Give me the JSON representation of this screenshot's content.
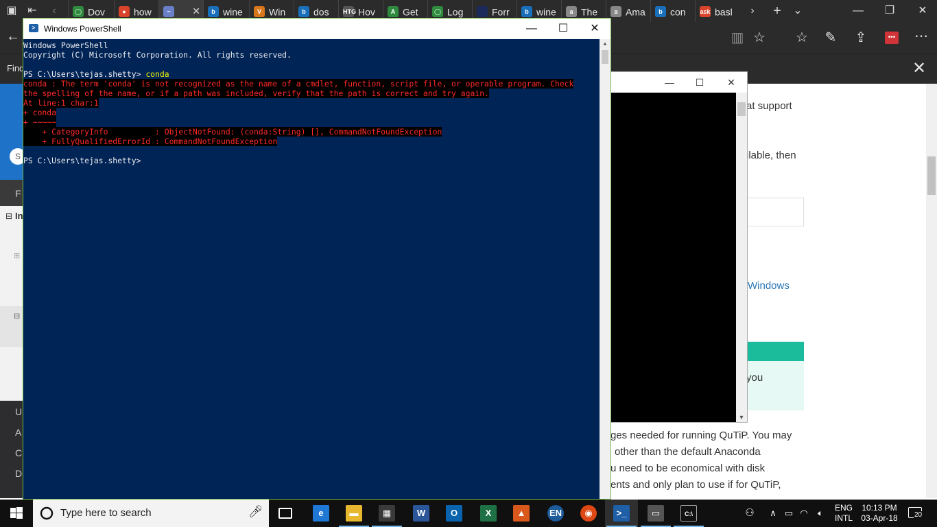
{
  "browser": {
    "tabs": [
      {
        "label": "Dov",
        "color": "#2e8b3e",
        "glyph": "◯"
      },
      {
        "label": "how",
        "color": "#d9442c",
        "glyph": "●"
      },
      {
        "label": "",
        "color": "#6a7fc8",
        "glyph": "~"
      },
      {
        "label": "wine",
        "color": "#1a6fba",
        "glyph": "b"
      },
      {
        "label": "Win",
        "color": "#d8761c",
        "glyph": "V"
      },
      {
        "label": "dos",
        "color": "#1a6fba",
        "glyph": "b"
      },
      {
        "label": "Hov",
        "color": "#555555",
        "glyph": "HTG"
      },
      {
        "label": "Get",
        "color": "#2e8b3e",
        "glyph": "A"
      },
      {
        "label": "Log",
        "color": "#2e8b3e",
        "glyph": "◯"
      },
      {
        "label": "Forr",
        "color": "#1b2a5a",
        "glyph": ""
      },
      {
        "label": "wine",
        "color": "#1a6fba",
        "glyph": "b"
      },
      {
        "label": "The",
        "color": "#888888",
        "glyph": "a"
      },
      {
        "label": "Ama",
        "color": "#888888",
        "glyph": "a"
      },
      {
        "label": "con",
        "color": "#1a6fba",
        "glyph": "b"
      },
      {
        "label": "basl",
        "color": "#d9442c",
        "glyph": "ask"
      }
    ],
    "find_label": "Find",
    "sidebar_letters": [
      "F",
      "U",
      "A",
      "C",
      "D"
    ],
    "sidebar_bold": "In",
    "page_fragments": [
      "at support",
      "ilable, then",
      "Windows",
      "you",
      "ges needed for running QuTiP. You may",
      "other than the default Anaconda",
      "u need to be economical with disk",
      "ents and only plan to use if for QuTiP,"
    ]
  },
  "powershell": {
    "title": "Windows PowerShell",
    "lines": [
      {
        "text": "Windows PowerShell",
        "type": "normal"
      },
      {
        "text": "Copyright (C) Microsoft Corporation. All rights reserved.",
        "type": "normal"
      },
      {
        "text": "",
        "type": "normal"
      },
      {
        "text": "PS C:\\Users\\tejas.shetty> ",
        "cmd": "conda",
        "type": "prompt"
      },
      {
        "text": "conda : The term 'conda' is not recognized as the name of a cmdlet, function, script file, or operable program. Check",
        "type": "error"
      },
      {
        "text": "the spelling of the name, or if a path was included, verify that the path is correct and try again.",
        "type": "error"
      },
      {
        "text": "At line:1 char:1",
        "type": "error"
      },
      {
        "text": "+ conda",
        "type": "error"
      },
      {
        "text": "+ ~~~~~",
        "type": "error"
      },
      {
        "text": "    + CategoryInfo          : ObjectNotFound: (conda:String) [], CommandNotFoundException",
        "type": "error"
      },
      {
        "text": "    + FullyQualifiedErrorId : CommandNotFoundException",
        "type": "error"
      },
      {
        "text": "",
        "type": "normal"
      },
      {
        "text": "PS C:\\Users\\tejas.shetty>",
        "type": "normal"
      }
    ]
  },
  "taskbar": {
    "search_placeholder": "Type here to search",
    "apps": [
      {
        "name": "task-view",
        "glyph": "▭",
        "color": "transparent"
      },
      {
        "name": "edge",
        "glyph": "e",
        "color": "#1e78d4"
      },
      {
        "name": "file-explorer",
        "glyph": "▬",
        "color": "#e8b730"
      },
      {
        "name": "store",
        "glyph": "▦",
        "color": "#3a3a3a"
      },
      {
        "name": "word",
        "glyph": "W",
        "color": "#2b579a"
      },
      {
        "name": "outlook",
        "glyph": "O",
        "color": "#0a64ad"
      },
      {
        "name": "excel",
        "glyph": "X",
        "color": "#1e7145"
      },
      {
        "name": "matlab",
        "glyph": "▲",
        "color": "#d9581c"
      },
      {
        "name": "language",
        "glyph": "EN",
        "color": "#1c5a9a"
      },
      {
        "name": "ubuntu",
        "glyph": "◉",
        "color": "#dd4814"
      },
      {
        "name": "powershell",
        "glyph": ">_",
        "color": "#1f5fa8"
      },
      {
        "name": "console-window",
        "glyph": "▭",
        "color": "#555555"
      },
      {
        "name": "cmd",
        "glyph": "C:\\",
        "color": "#111111"
      }
    ],
    "lang_top": "ENG",
    "lang_bottom": "INTL",
    "time": "10:13 PM",
    "date": "03-Apr-18",
    "notification_count": "20"
  }
}
